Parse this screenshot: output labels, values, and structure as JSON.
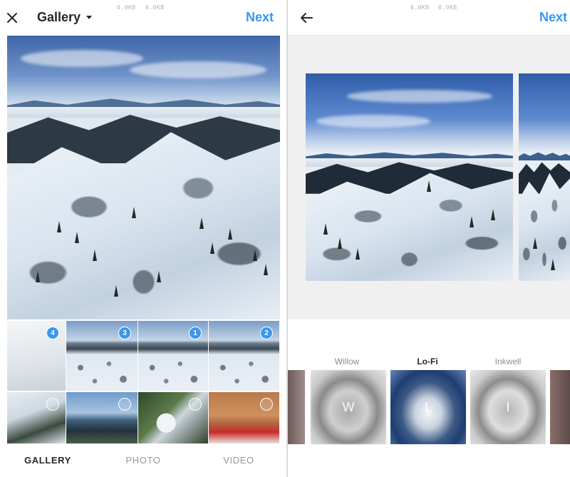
{
  "left": {
    "status_netspeed": [
      "0.0KB",
      "0.0KB"
    ],
    "header": {
      "close_icon": "close-icon",
      "title": "Gallery",
      "dropdown_icon": "caret-down-icon",
      "next_label": "Next"
    },
    "thumbnails": [
      {
        "badge": "4",
        "selected": true
      },
      {
        "badge": "3",
        "selected": true
      },
      {
        "badge": "1",
        "selected": true
      },
      {
        "badge": "2",
        "selected": true
      },
      {
        "badge": "",
        "selected": false
      },
      {
        "badge": "",
        "selected": false
      },
      {
        "badge": "",
        "selected": false
      },
      {
        "badge": "",
        "selected": false
      }
    ],
    "tabs": [
      {
        "label": "GALLERY",
        "active": true
      },
      {
        "label": "PHOTO",
        "active": false
      },
      {
        "label": "VIDEO",
        "active": false
      }
    ]
  },
  "right": {
    "status_netspeed": [
      "0.0KB",
      "0.0KB"
    ],
    "header": {
      "back_icon": "arrow-left-icon",
      "next_label": "Next"
    },
    "filters": [
      {
        "name": "",
        "initial": ""
      },
      {
        "name": "Willow",
        "initial": "W",
        "selected": false
      },
      {
        "name": "Lo-Fi",
        "initial": "L",
        "selected": true
      },
      {
        "name": "Inkwell",
        "initial": "I",
        "selected": false
      },
      {
        "name": "",
        "initial": ""
      }
    ]
  },
  "colors": {
    "accent": "#3897f0",
    "text": "#262626",
    "muted": "#8e8e8e"
  }
}
